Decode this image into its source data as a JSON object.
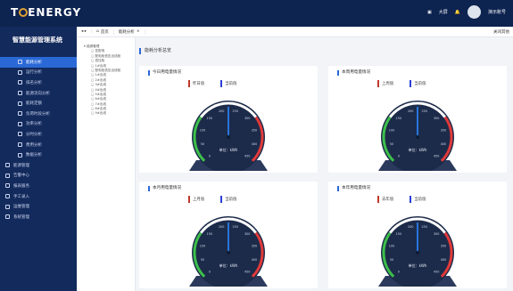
{
  "header": {
    "brand": "T  ENERGY",
    "toolbar_label": "大屏",
    "user_name": "演示账号"
  },
  "sidebar": {
    "title": "智慧能源管理系统",
    "items": [
      {
        "label": "能耗分析",
        "level": "sub",
        "active": true
      },
      {
        "label": "运行分析",
        "level": "sub"
      },
      {
        "label": "排名分析",
        "level": "sub"
      },
      {
        "label": "能源流向分析",
        "level": "sub"
      },
      {
        "label": "能耗定额",
        "level": "sub"
      },
      {
        "label": "负荷时段分析",
        "level": "sub"
      },
      {
        "label": "功率分析",
        "level": "sub"
      },
      {
        "label": "分时分析",
        "level": "sub"
      },
      {
        "label": "费用分析",
        "level": "sub"
      },
      {
        "label": "数据分析",
        "level": "sub"
      },
      {
        "label": "能源管理",
        "level": "top"
      },
      {
        "label": "告警中心",
        "level": "top"
      },
      {
        "label": "报表服务",
        "level": "top"
      },
      {
        "label": "手工录入",
        "level": "top"
      },
      {
        "label": "运维管理",
        "level": "top"
      },
      {
        "label": "系统管理",
        "level": "top"
      }
    ]
  },
  "tabs": {
    "home": "首页",
    "current": "能耗分析",
    "right_label": "关闭其他"
  },
  "tree": {
    "root": "能源管理",
    "nodes": [
      "变配电",
      "配电柜低压出线柜",
      "低压柜",
      "1#出线",
      "配电柜低压出线柜",
      "1#出线",
      "2#出线",
      "3#出线",
      "4#出线",
      "5#出线",
      "6#出线",
      "7#出线",
      "8#出线",
      "9#出线"
    ]
  },
  "main": {
    "section_title": "能耗分析总览",
    "panels": [
      {
        "title": "今日用电量情况",
        "legend_a": "昨日值",
        "legend_b": "当前值",
        "unit": "单位：kWh"
      },
      {
        "title": "本周用电量情况",
        "legend_a": "上周值",
        "legend_b": "当前值",
        "unit": "单位：kWh"
      },
      {
        "title": "本月用电量情况",
        "legend_a": "上月值",
        "legend_b": "当前值",
        "unit": "单位：kWh"
      },
      {
        "title": "本年用电量情况",
        "legend_a": "去年值",
        "legend_b": "当前值",
        "unit": "单位：kWh"
      }
    ]
  },
  "gauge": {
    "tick_labels": [
      "0",
      "50",
      "100",
      "150",
      "200",
      "250",
      "300",
      "350",
      "400",
      "450"
    ],
    "pointer_value": 0.5
  },
  "colors": {
    "accent": "#2a68d6",
    "legend_a": "#c0392b",
    "legend_b": "#2a3fd6",
    "gauge_bg": "#1d2b4a",
    "needle": "#2a88ff"
  }
}
